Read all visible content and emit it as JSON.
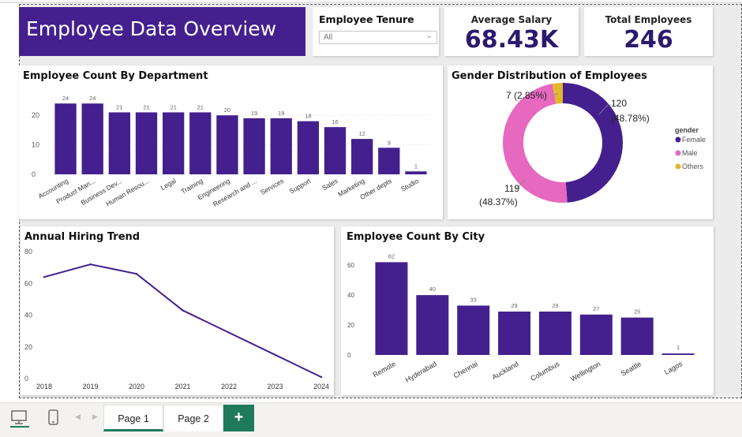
{
  "dashboard": {
    "title": "Employee Data Overview"
  },
  "slicer": {
    "label": "Employee Tenure",
    "value": "All"
  },
  "kpis": {
    "avg_salary_label": "Average Salary",
    "avg_salary_value": "68.43K",
    "total_employees_label": "Total Employees",
    "total_employees_value": "246"
  },
  "charts": {
    "department_title": "Employee Count By Department",
    "gender_title": "Gender Distribution of Employees",
    "hiring_title": "Annual Hiring Trend",
    "city_title": "Employee Count By City"
  },
  "colors": {
    "primary": "#44208e",
    "female": "#44208e",
    "male": "#e668bf",
    "others": "#e3b72c",
    "accent_green": "#1f7a5b"
  },
  "pages": {
    "page1": "Page 1",
    "page2": "Page 2",
    "add": "+"
  },
  "chart_data": [
    {
      "type": "bar",
      "title": "Employee Count By Department",
      "categories": [
        "Accounting",
        "Product Man...",
        "Business Dev...",
        "Human Resou...",
        "Legal",
        "Training",
        "Engineering",
        "Research and ...",
        "Services",
        "Support",
        "Sales",
        "Marketing",
        "Other depts",
        "Studio"
      ],
      "values": [
        24,
        24,
        21,
        21,
        21,
        21,
        20,
        19,
        19,
        18,
        16,
        12,
        9,
        1
      ],
      "yticks": [
        "0",
        "10",
        "20"
      ],
      "ylim": [
        0,
        27
      ],
      "grid": true
    },
    {
      "type": "pie",
      "title": "Gender Distribution of Employees",
      "legend_title": "gender",
      "legend_position": "right",
      "slices": [
        {
          "name": "Female",
          "value": 120,
          "label_count": "120",
          "label_pct": "(48.78%)"
        },
        {
          "name": "Male",
          "value": 119,
          "label_count": "119",
          "label_pct": "(48.37%)"
        },
        {
          "name": "Others",
          "value": 7,
          "label_count": "7",
          "label_pct": "(2.85%)"
        }
      ]
    },
    {
      "type": "line",
      "title": "Annual Hiring Trend",
      "x": [
        "2018",
        "2019",
        "2020",
        "2021",
        "2022",
        "2023",
        "2024"
      ],
      "values": [
        64,
        72,
        66,
        43,
        29,
        15,
        1
      ],
      "yticks": [
        "0",
        "20",
        "40",
        "60",
        "80"
      ],
      "ylim": [
        0,
        80
      ]
    },
    {
      "type": "bar",
      "title": "Employee Count By City",
      "categories": [
        "Remote",
        "Hyderabad",
        "Chennai",
        "Auckland",
        "Columbus",
        "Wellington",
        "Seattle",
        "Lagos"
      ],
      "values": [
        62,
        40,
        33,
        29,
        29,
        27,
        25,
        1
      ],
      "yticks": [
        "0",
        "20",
        "40",
        "60"
      ],
      "ylim": [
        0,
        68
      ]
    }
  ]
}
